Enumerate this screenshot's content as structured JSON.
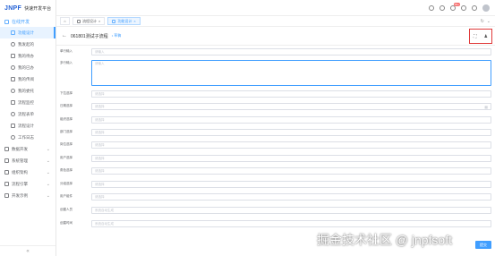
{
  "app": {
    "logo": "JNPF",
    "name": "快速开发平台"
  },
  "sidebar": {
    "group": {
      "label": "在线开发"
    },
    "items": [
      {
        "label": "功能设计",
        "active": true
      },
      {
        "label": "我发起的"
      },
      {
        "label": "我的待办"
      },
      {
        "label": "我的已办"
      },
      {
        "label": "我的传阅"
      },
      {
        "label": "我的委托"
      },
      {
        "label": "流程监控"
      },
      {
        "label": "流程表单"
      },
      {
        "label": "流程设计"
      },
      {
        "label": "工作日志"
      }
    ],
    "collapsed_groups": [
      {
        "label": "数据开发"
      },
      {
        "label": "系统管理"
      },
      {
        "label": "组织架构"
      },
      {
        "label": "流程引擎"
      },
      {
        "label": "开发示例"
      }
    ],
    "footer_toggle": "«"
  },
  "topbar": {
    "badge": "99+"
  },
  "tabs": [
    {
      "label": "流程设计",
      "close": "×"
    },
    {
      "label": "功能设计",
      "close": "×",
      "active": true
    }
  ],
  "panel": {
    "title": "061801测试子流程",
    "subtitle": "• 草稿",
    "fullscreen_icon": "⛶",
    "user_icon": "♟"
  },
  "form": {
    "fields": [
      {
        "label": "单行输入",
        "placeholder": "请输入"
      },
      {
        "label": "多行输入",
        "placeholder": "请输入"
      },
      {
        "label": "下拉选择",
        "placeholder": "请选择"
      },
      {
        "label": "日期选择",
        "placeholder": "请选择",
        "icon": "▦"
      },
      {
        "label": "组织选择",
        "placeholder": "请选择"
      },
      {
        "label": "部门选择",
        "placeholder": "请选择"
      },
      {
        "label": "岗位选择",
        "placeholder": "请选择"
      },
      {
        "label": "用户选择",
        "placeholder": "请选择"
      },
      {
        "label": "角色选择",
        "placeholder": "请选择"
      },
      {
        "label": "分组选择",
        "placeholder": "请选择"
      },
      {
        "label": "用户组件",
        "placeholder": "请选择"
      },
      {
        "label": "创建人员",
        "placeholder": "系统自动生成"
      },
      {
        "label": "创建时间",
        "placeholder": "系统自动生成"
      }
    ]
  },
  "watermark": "掘金技术社区 @ jnpfsoft",
  "fab_label": "提交"
}
